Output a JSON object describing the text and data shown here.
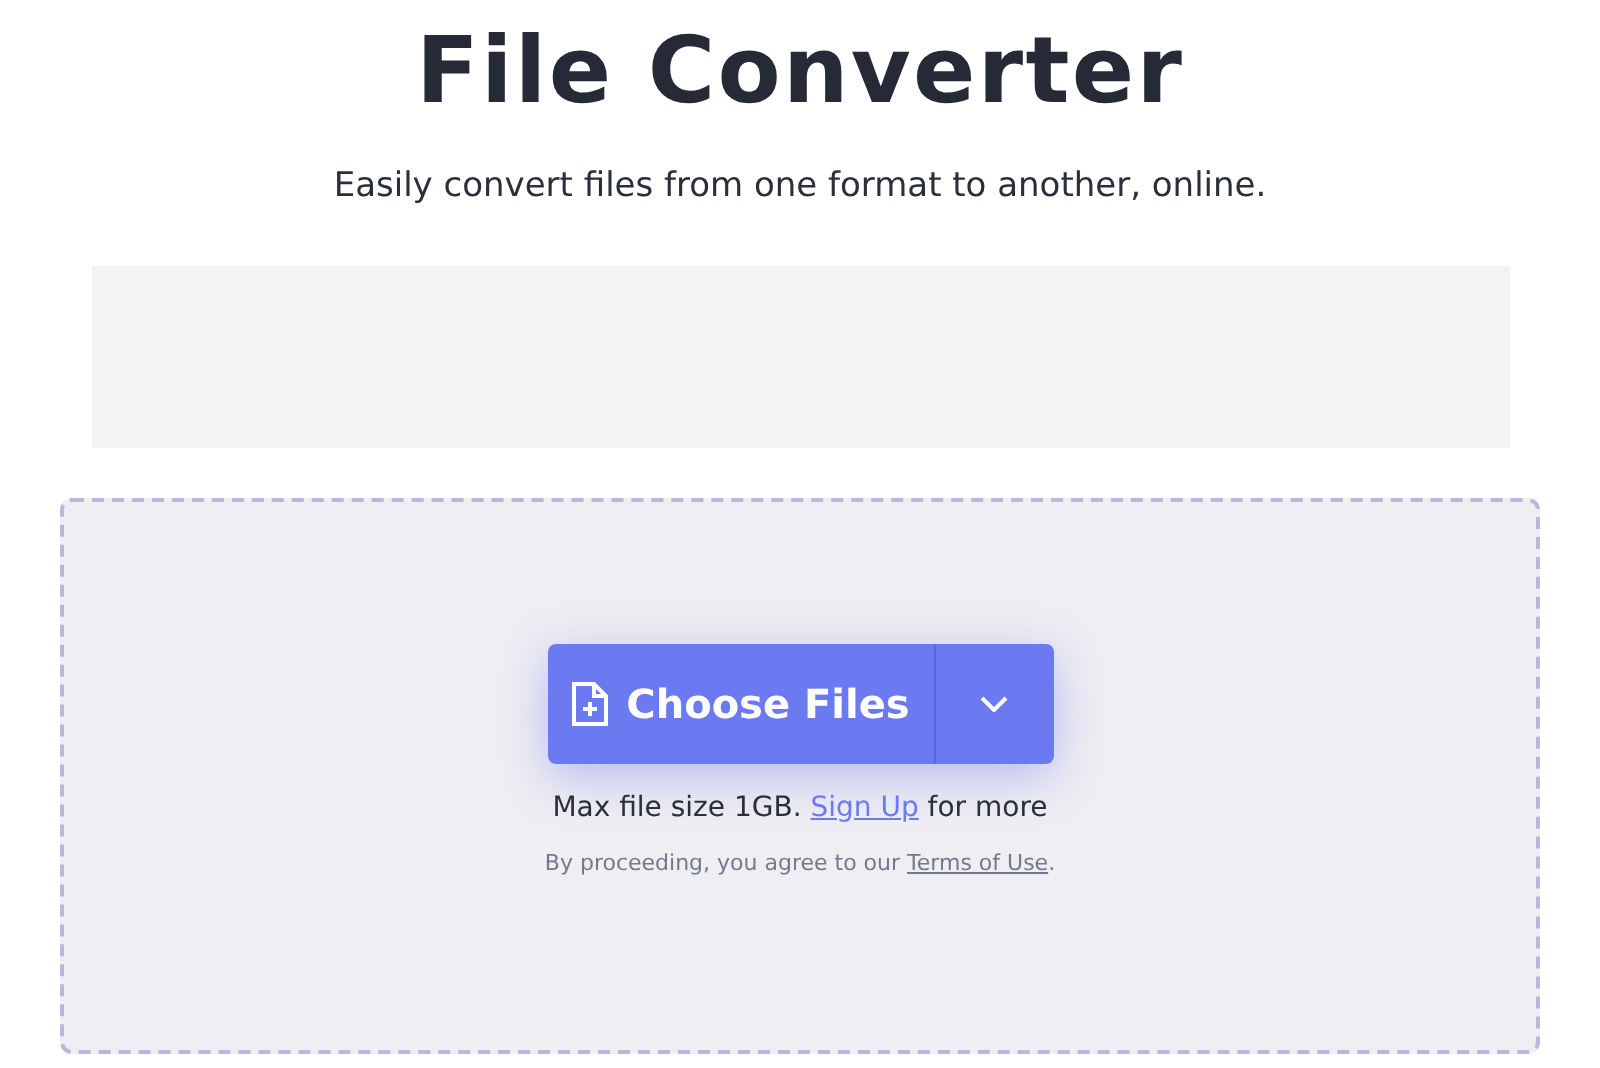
{
  "title": "File Converter",
  "subtitle": "Easily convert files from one format to another, online.",
  "upload": {
    "button": "Choose Files",
    "limit": {
      "before": "Max file size 1GB.",
      "link": "Sign Up",
      "after": "for more"
    },
    "terms": {
      "before": "By proceeding, you agree to our",
      "link": "Terms of Use",
      "after": "."
    }
  }
}
